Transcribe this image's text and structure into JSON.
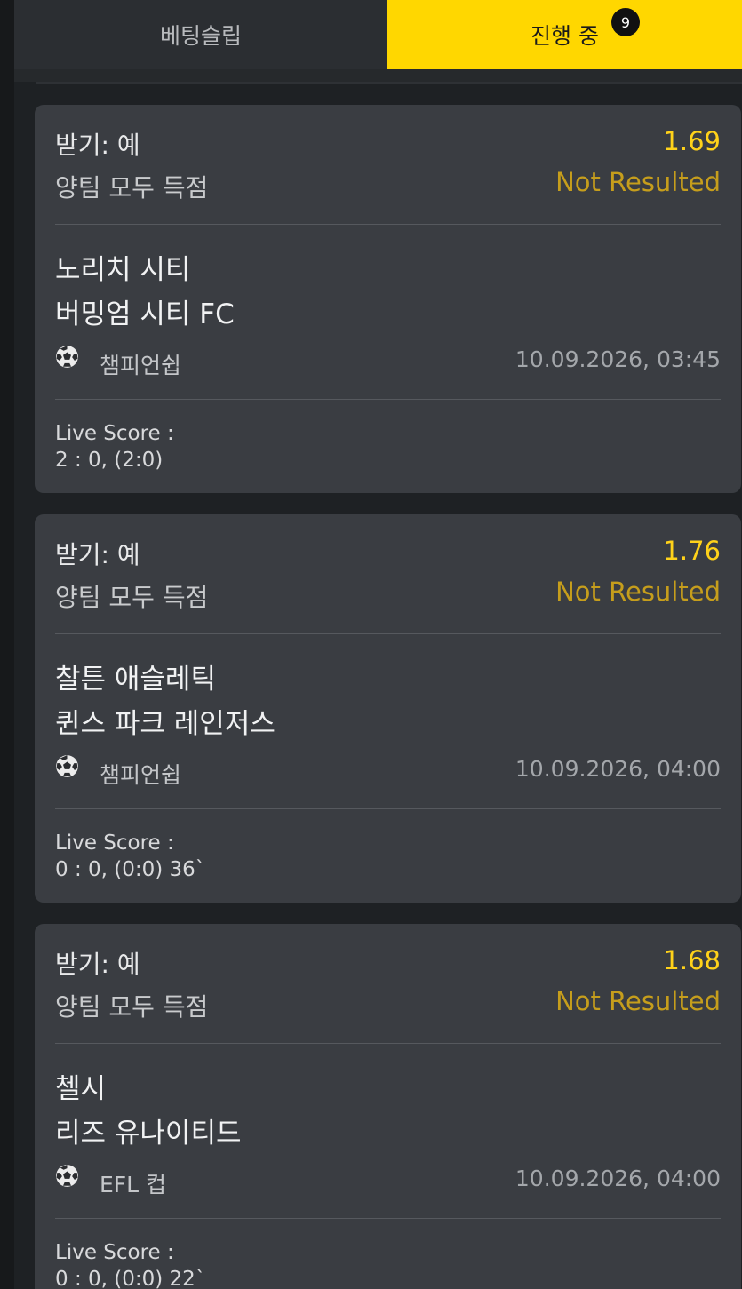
{
  "tabs": {
    "betslip_label": "베팅슬립",
    "active_label": "진행 중",
    "active_badge": "9"
  },
  "bets": [
    {
      "selection": "받기: 예",
      "market": "양팀 모두 득점",
      "odds": "1.69",
      "status": "Not Resulted",
      "home": "노리치 시티",
      "away": "버밍엄 시티 FC",
      "sport_icon": "soccer-ball-icon",
      "league": "챔피언쉽",
      "datetime": "10.09.2026, 03:45",
      "live_score_label": "Live Score :",
      "live_score_value": "2 : 0, (2:0)"
    },
    {
      "selection": "받기: 예",
      "market": "양팀 모두 득점",
      "odds": "1.76",
      "status": "Not Resulted",
      "home": "찰튼 애슬레틱",
      "away": "퀸스 파크 레인저스",
      "sport_icon": "soccer-ball-icon",
      "league": "챔피언쉽",
      "datetime": "10.09.2026, 04:00",
      "live_score_label": "Live Score :",
      "live_score_value": "0 : 0, (0:0) 36`"
    },
    {
      "selection": "받기: 예",
      "market": "양팀 모두 득점",
      "odds": "1.68",
      "status": "Not Resulted",
      "home": "첼시",
      "away": "리즈 유나이티드",
      "sport_icon": "soccer-ball-icon",
      "league": "EFL 컵",
      "datetime": "10.09.2026, 04:00",
      "live_score_label": "Live Score :",
      "live_score_value": "0 : 0, (0:0) 22`"
    }
  ],
  "colors": {
    "accent": "#ffd700",
    "odds": "#ffd21a",
    "status": "#c69e1c",
    "card_bg": "#3a3d42"
  }
}
